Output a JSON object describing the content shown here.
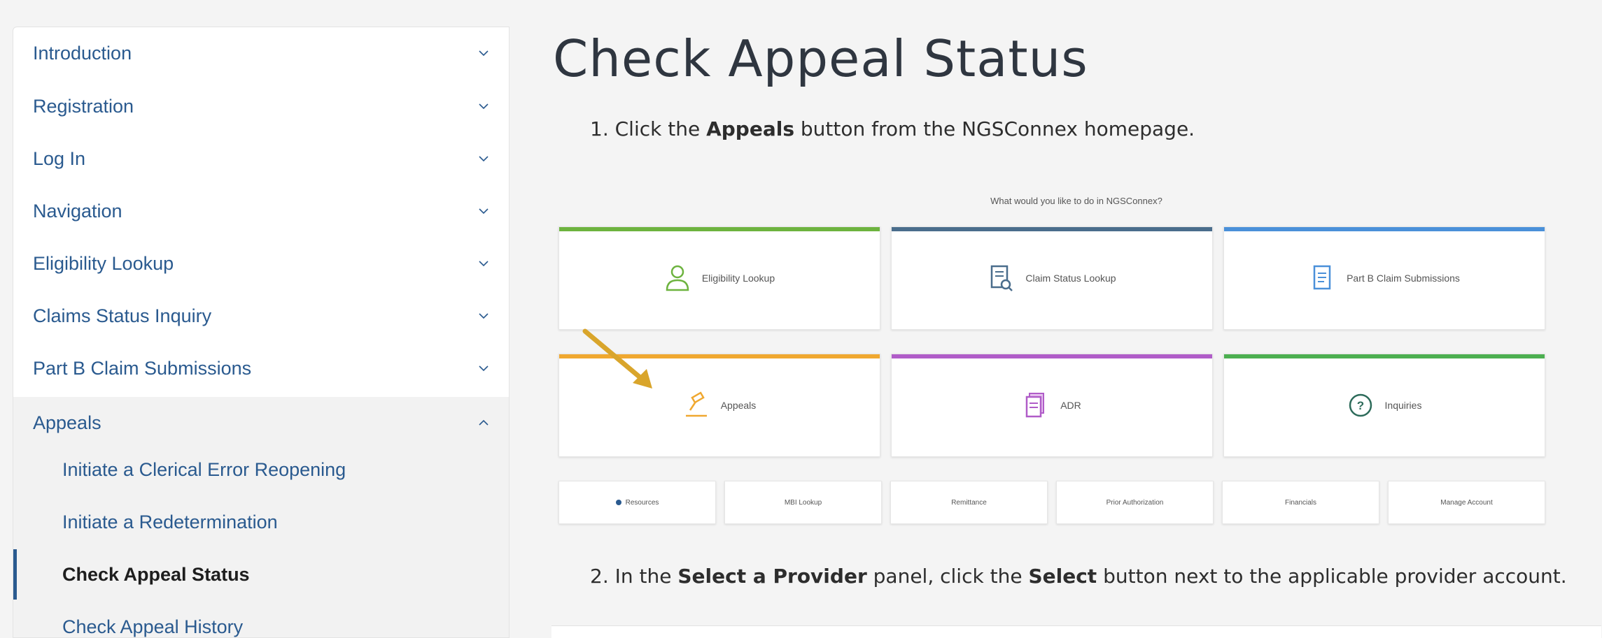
{
  "sidebar": {
    "items": [
      {
        "label": "Introduction"
      },
      {
        "label": "Registration"
      },
      {
        "label": "Log In"
      },
      {
        "label": "Navigation"
      },
      {
        "label": "Eligibility Lookup"
      },
      {
        "label": "Claims Status Inquiry"
      },
      {
        "label": "Part B Claim Submissions"
      },
      {
        "label": "Appeals"
      }
    ],
    "appeals_subitems": [
      {
        "label": "Initiate a Clerical Error Reopening"
      },
      {
        "label": "Initiate a Redetermination"
      },
      {
        "label": "Check Appeal Status",
        "active": true
      },
      {
        "label": "Check Appeal History"
      }
    ]
  },
  "main": {
    "title": "Check Appeal Status",
    "step1": {
      "prefix": "1. Click the ",
      "bold": "Appeals",
      "suffix": " button from the NGSConnex homepage."
    },
    "step2": {
      "prefix": "2. In the ",
      "bold1": "Select a Provider",
      "middle": " panel, click the ",
      "bold2": "Select",
      "suffix": " button next to the applicable provider account."
    }
  },
  "screenshot": {
    "question": "What would you like to do in NGSConnex?",
    "tiles": [
      {
        "label": "Eligibility Lookup",
        "color": "#6db33f",
        "icon": "person-icon"
      },
      {
        "label": "Claim Status Lookup",
        "color": "#4a6d8c",
        "icon": "document-search-icon"
      },
      {
        "label": "Part B Claim Submissions",
        "color": "#4a90d9",
        "icon": "document-icon"
      },
      {
        "label": "Appeals",
        "color": "#f0a830",
        "icon": "gavel-icon"
      },
      {
        "label": "ADR",
        "color": "#b05cc8",
        "icon": "document-stack-icon"
      },
      {
        "label": "Inquiries",
        "color": "#4caf50",
        "icon": "question-icon"
      }
    ],
    "links": [
      {
        "label": "Resources"
      },
      {
        "label": "MBI Lookup"
      },
      {
        "label": "Remittance"
      },
      {
        "label": "Prior Authorization"
      },
      {
        "label": "Financials"
      },
      {
        "label": "Manage Account"
      }
    ]
  },
  "colors": {
    "nav_text": "#2a5a8f",
    "arrow": "#d9a52b"
  }
}
